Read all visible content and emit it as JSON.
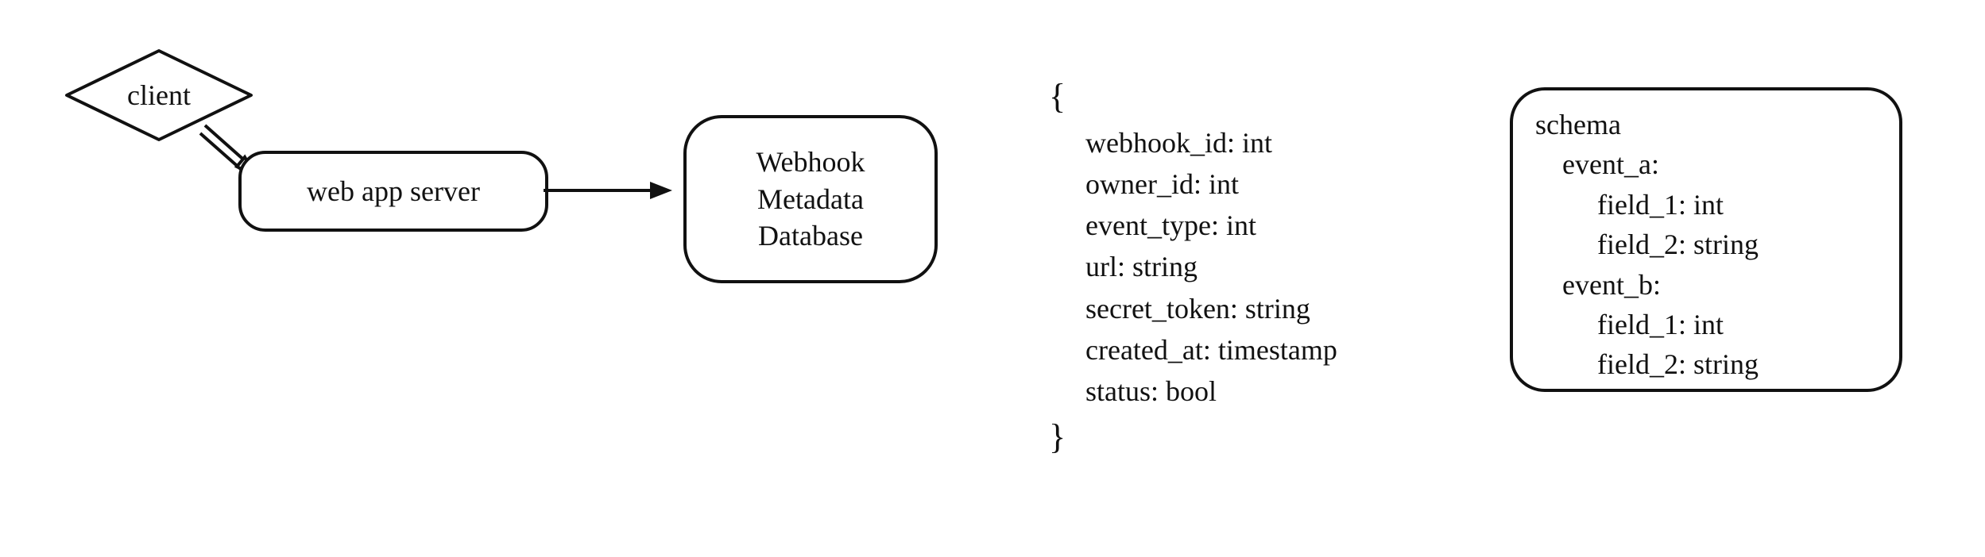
{
  "nodes": {
    "client": "client",
    "server": "web app server",
    "database": "Webhook\nMetadata\nDatabase"
  },
  "record": {
    "open": "{",
    "close": "}",
    "fields": [
      "webhook_id: int",
      "owner_id: int",
      "event_type: int",
      "url: string",
      "secret_token: string",
      "created_at: timestamp",
      "status: bool"
    ]
  },
  "schema": {
    "title": "schema",
    "events": [
      {
        "name": "event_a:",
        "fields": [
          "field_1: int",
          "field_2: string"
        ]
      },
      {
        "name": "event_b:",
        "fields": [
          "field_1: int",
          "field_2: string"
        ]
      }
    ]
  }
}
